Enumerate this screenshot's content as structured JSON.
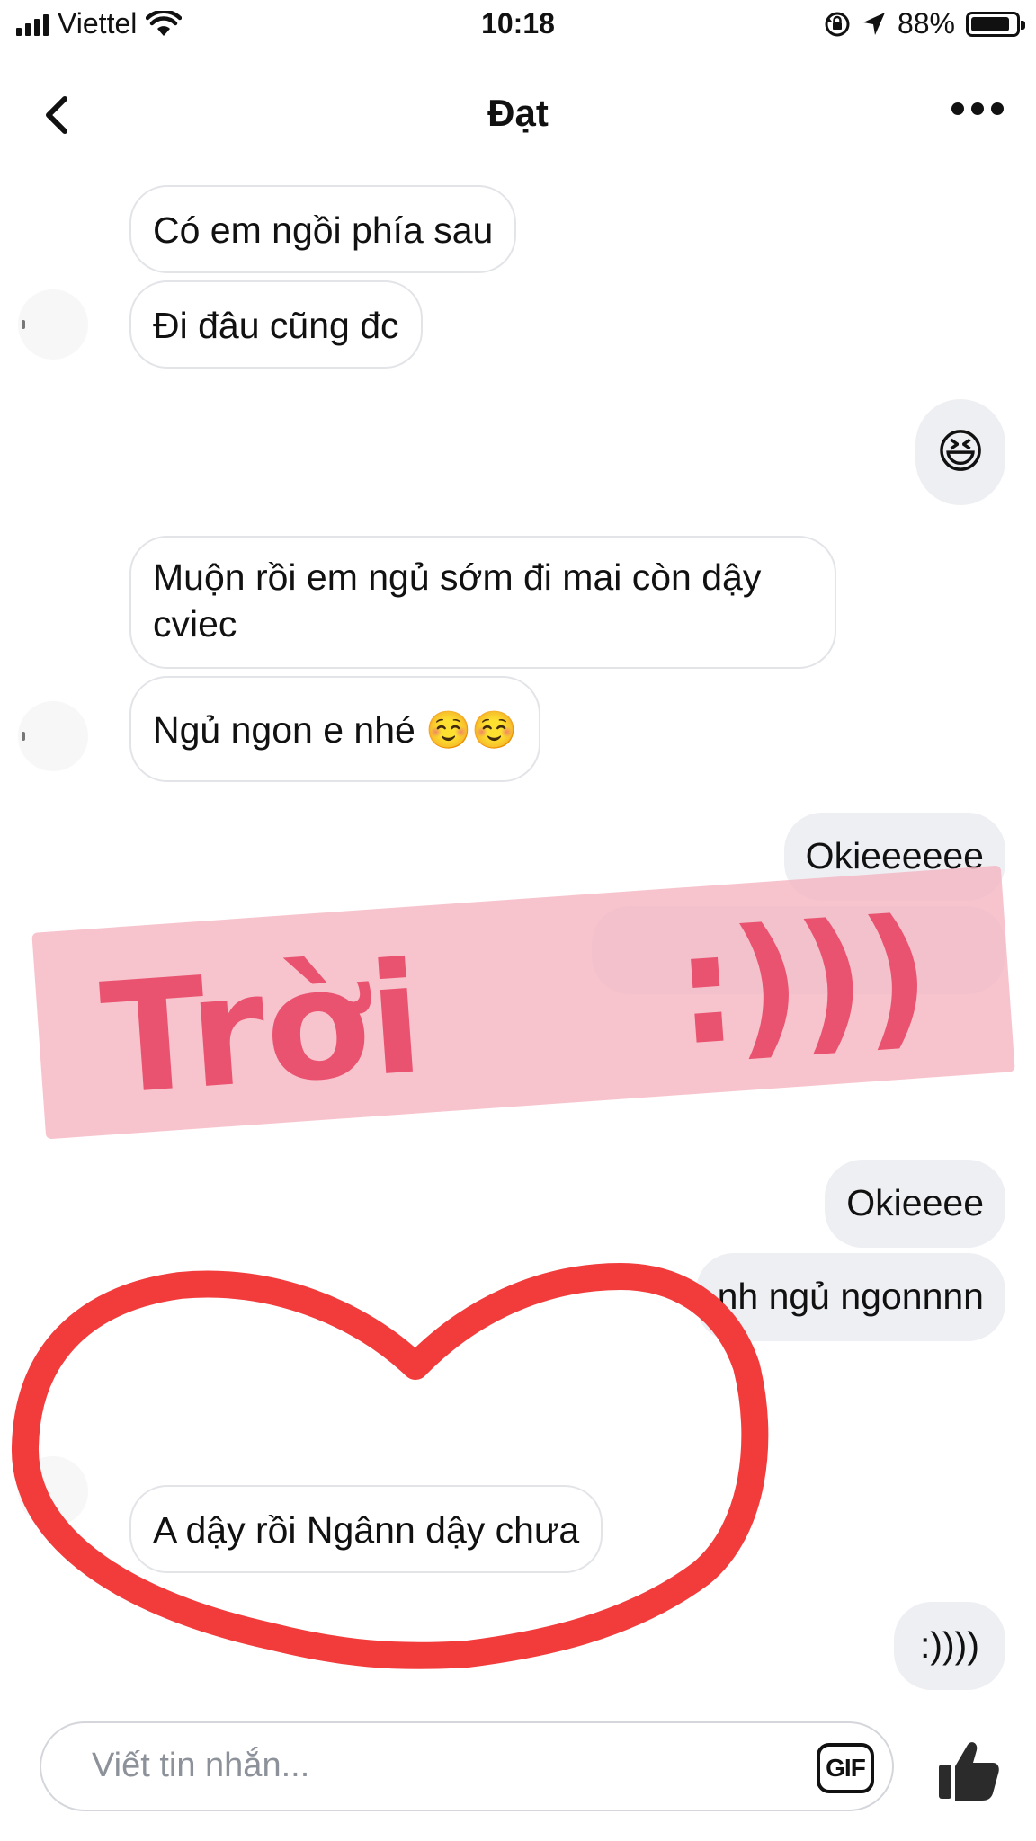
{
  "status_bar": {
    "carrier": "Viettel",
    "time": "10:18",
    "battery_pct": "88%",
    "battery_level": 0.88
  },
  "header": {
    "title": "Đạt"
  },
  "messages": [
    {
      "id": "m1",
      "text": "Có em ngồi phía sau",
      "sender": "contact"
    },
    {
      "id": "m2",
      "text": "Đi đâu cũng đc",
      "sender": "contact"
    },
    {
      "id": "m3",
      "text": "😆",
      "sender": "me"
    },
    {
      "id": "m4",
      "text": "Muộn rồi em ngủ sớm đi mai còn dậy cviec",
      "sender": "contact"
    },
    {
      "id": "m5",
      "text": "Ngủ ngon e nhé ☺️☺️",
      "sender": "contact"
    },
    {
      "id": "m6",
      "text": "Okieeeeee",
      "sender": "me"
    },
    {
      "id": "m7",
      "text": "Okieeee",
      "sender": "me"
    },
    {
      "id": "m8",
      "text": "nh ngủ ngonnnn",
      "sender": "me"
    },
    {
      "id": "m9",
      "text": "A dậy rồi Ngânn dậy chưa",
      "sender": "contact"
    },
    {
      "id": "m10",
      "text": ":))))",
      "sender": "me"
    }
  ],
  "overlay": {
    "word": "Trời",
    "smiley": ":)))"
  },
  "composer": {
    "placeholder": "Viết tin nhắn...",
    "gif_label": "GIF"
  },
  "colors": {
    "incoming_border": "#e3e4e8",
    "outgoing_bg": "#eeeff3",
    "watermark_bg": "#f5b4c0",
    "watermark_text": "#ea5370",
    "heart_stroke": "#f23c3c"
  }
}
